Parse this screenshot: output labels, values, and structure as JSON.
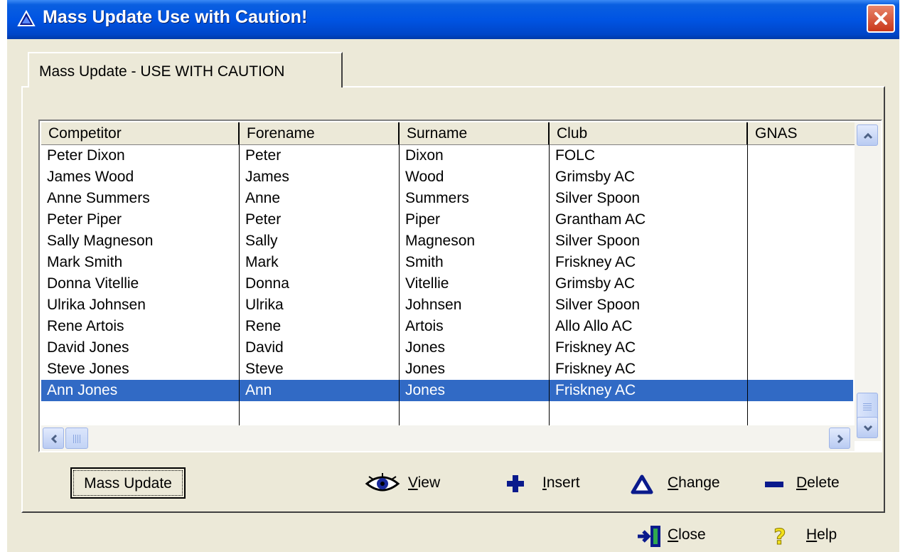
{
  "window": {
    "title": "Mass Update Use with Caution!"
  },
  "tab": {
    "label": "Mass Update - USE WITH CAUTION"
  },
  "table": {
    "columns": [
      "Competitor",
      "Forename",
      "Surname",
      "Club",
      "GNAS"
    ],
    "rows": [
      [
        "Peter Dixon",
        "Peter",
        "Dixon",
        "FOLC",
        ""
      ],
      [
        "James Wood",
        "James",
        "Wood",
        "Grimsby AC",
        ""
      ],
      [
        "Anne Summers",
        "Anne",
        "Summers",
        "Silver Spoon",
        ""
      ],
      [
        "Peter Piper",
        "Peter",
        "Piper",
        "Grantham AC",
        ""
      ],
      [
        "Sally Magneson",
        "Sally",
        "Magneson",
        "Silver Spoon",
        ""
      ],
      [
        "Mark Smith",
        "Mark",
        "Smith",
        "Friskney AC",
        ""
      ],
      [
        "Donna Vitellie",
        "Donna",
        "Vitellie",
        "Grimsby AC",
        ""
      ],
      [
        "Ulrika Johnsen",
        "Ulrika",
        "Johnsen",
        "Silver Spoon",
        ""
      ],
      [
        "Rene Artois",
        "Rene",
        "Artois",
        "Allo Allo AC",
        ""
      ],
      [
        "David Jones",
        "David",
        "Jones",
        "Friskney AC",
        ""
      ],
      [
        "Steve Jones",
        "Steve",
        "Jones",
        "Friskney AC",
        ""
      ],
      [
        "Ann Jones",
        "Ann",
        "Jones",
        "Friskney AC",
        ""
      ]
    ],
    "selected_row": 11
  },
  "buttons": {
    "mass_update": "Mass Update",
    "view": {
      "accel": "V",
      "rest": "iew"
    },
    "insert": {
      "accel": "I",
      "rest": "nsert"
    },
    "change": {
      "accel": "C",
      "rest": "hange"
    },
    "delete": {
      "accel": "D",
      "rest": "elete"
    },
    "close": {
      "accel": "C",
      "rest": "lose"
    },
    "help": {
      "accel": "H",
      "rest": "elp"
    }
  },
  "icons": {
    "title": "warning-triangle-icon",
    "view": "eye-icon",
    "insert": "plus-icon",
    "change": "triangle-icon",
    "delete": "minus-icon",
    "close": "exit-door-icon",
    "help": "question-mark-icon"
  },
  "colors": {
    "titlebar": "#0054e3",
    "selection": "#316ac5",
    "dialog_bg": "#ece9d8",
    "icon_blue": "#0a1a8c"
  }
}
